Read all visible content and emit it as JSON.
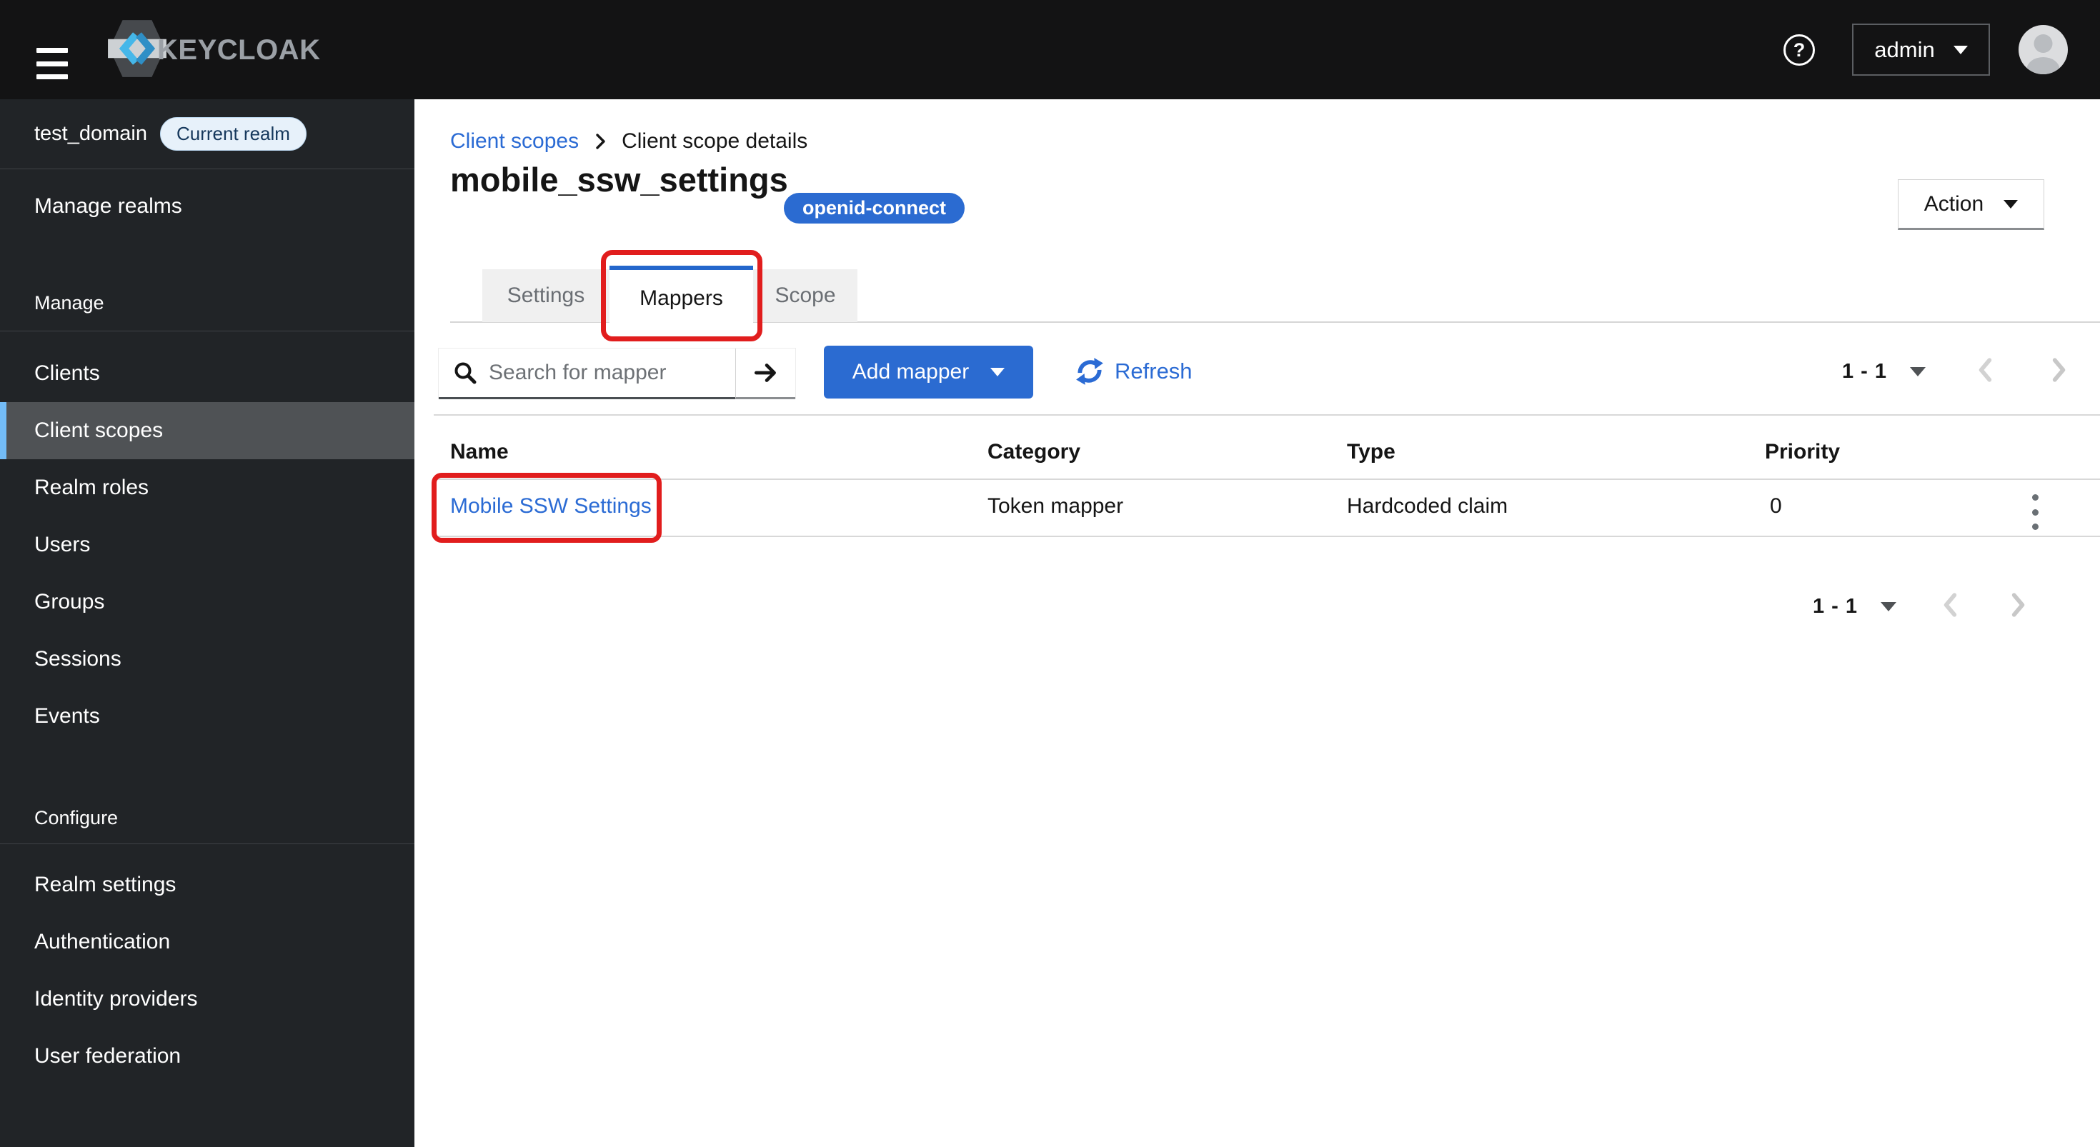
{
  "header": {
    "brand": "KEYCLOAK",
    "username": "admin"
  },
  "sidebar": {
    "realm_name": "test_domain",
    "realm_badge": "Current realm",
    "manage_realms": "Manage realms",
    "manage_section": "Manage",
    "manage_items": [
      "Clients",
      "Client scopes",
      "Realm roles",
      "Users",
      "Groups",
      "Sessions",
      "Events"
    ],
    "selected_item": "Client scopes",
    "configure_section": "Configure",
    "configure_items": [
      "Realm settings",
      "Authentication",
      "Identity providers",
      "User federation"
    ]
  },
  "breadcrumb": {
    "parent": "Client scopes",
    "current": "Client scope details"
  },
  "page": {
    "title": "mobile_ssw_settings",
    "protocol_badge": "openid-connect",
    "action_button": "Action"
  },
  "tabs": [
    {
      "label": "Settings",
      "active": false
    },
    {
      "label": "Mappers",
      "active": true
    },
    {
      "label": "Scope",
      "active": false
    }
  ],
  "toolbar": {
    "search_placeholder": "Search for mapper",
    "add_mapper": "Add mapper",
    "refresh": "Refresh"
  },
  "pagination": {
    "top_range": "1 - 1",
    "bottom_range": "1 - 1"
  },
  "table": {
    "headers": [
      "Name",
      "Category",
      "Type",
      "Priority"
    ],
    "rows": [
      {
        "name": "Mobile SSW Settings",
        "category": "Token mapper",
        "type": "Hardcoded claim",
        "priority": "0"
      }
    ]
  },
  "icons": {
    "menu": "hamburger-bars",
    "help": "question-circle",
    "user": "person-avatar",
    "search": "magnifier",
    "search_submit": "arrow-right",
    "dropdown": "caret-down",
    "refresh": "sync-arrows",
    "prev": "chevron-left",
    "next": "chevron-right",
    "row_menu": "kebab-dots"
  },
  "colors": {
    "accent_blue": "#2b6bd1",
    "link_blue": "#2b6bd4",
    "tab_indicator": "#2467cc",
    "masthead_bg": "#131314",
    "sidebar_bg": "#212427",
    "selected_nav_bg": "#4f5255",
    "selected_nav_accent": "#73bcf7",
    "realm_badge_bg": "#e7f1fa",
    "realm_badge_text": "#16385c",
    "annotation_red": "#e11d1d",
    "inactive_tab_bg": "#f0f0f0",
    "muted_text": "#6a6e73"
  }
}
